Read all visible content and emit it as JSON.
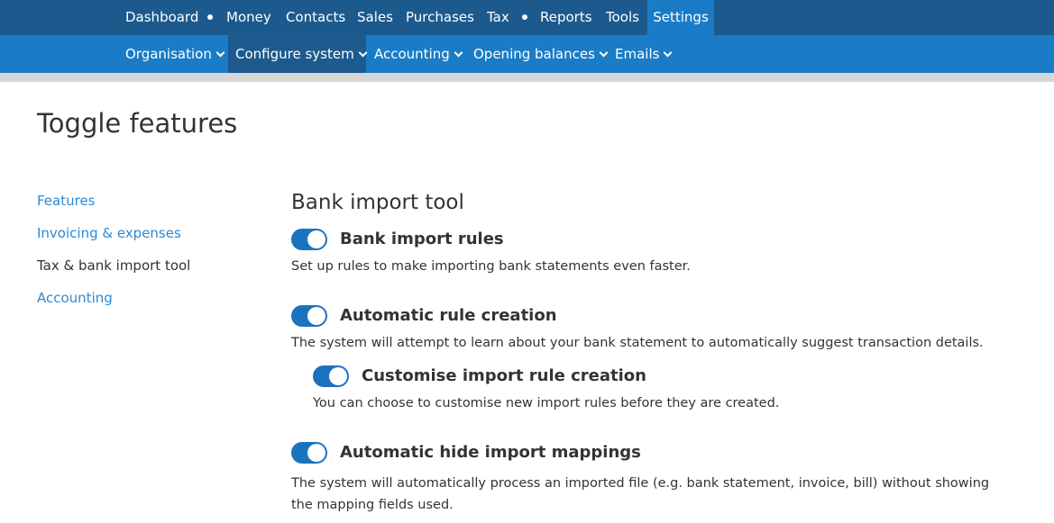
{
  "top_nav": {
    "items": [
      "Dashboard",
      "Money",
      "Contacts",
      "Sales",
      "Purchases",
      "Tax",
      "Reports",
      "Tools",
      "Settings"
    ],
    "active": "Settings"
  },
  "sub_nav": {
    "items": [
      "Organisation",
      "Configure system",
      "Accounting",
      "Opening balances",
      "Emails"
    ],
    "active": "Configure system"
  },
  "page": {
    "title": "Toggle features"
  },
  "sidebar": {
    "items": [
      "Features",
      "Invoicing & expenses",
      "Tax & bank import tool",
      "Accounting"
    ],
    "current": "Tax & bank import tool"
  },
  "section": {
    "title": "Bank import tool",
    "features": [
      {
        "label": "Bank import rules",
        "description": "Set up rules to make importing bank statements even faster.",
        "enabled": true
      },
      {
        "label": "Automatic rule creation",
        "description": "The system will attempt to learn about your bank statement to automatically suggest transaction details.",
        "enabled": true
      },
      {
        "label": "Customise import rule creation",
        "description": "You can choose to customise new import rules before they are created.",
        "enabled": true
      },
      {
        "label": "Automatic hide import mappings",
        "description": "The system will automatically process an imported file (e.g. bank statement, invoice, bill) without showing the mapping fields used.",
        "enabled": true
      }
    ]
  },
  "colors": {
    "top_nav_bg": "#1c5a8e",
    "sub_nav_bg": "#1a7cc6",
    "toggle_on": "#1b73c0",
    "link": "#2b8ad4"
  }
}
